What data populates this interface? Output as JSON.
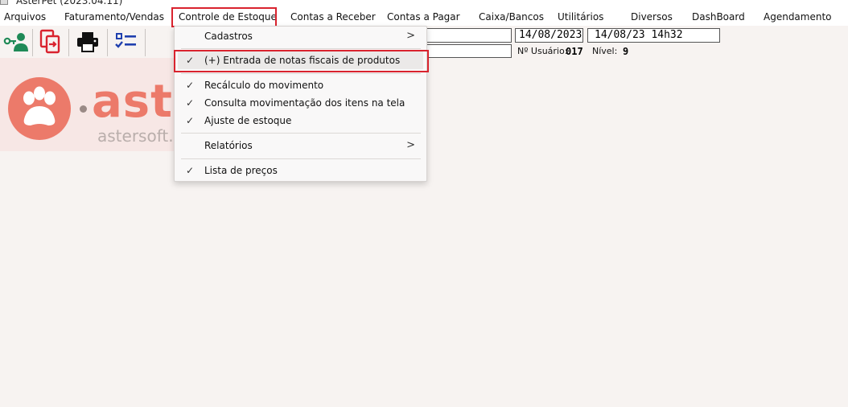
{
  "window": {
    "title": "AsterPet (2023.04.11)"
  },
  "menubar": [
    {
      "label": "Arquivos"
    },
    {
      "label": "Faturamento/Vendas"
    },
    {
      "label": "Controle de Estoque"
    },
    {
      "label": "Contas a Receber"
    },
    {
      "label": "Contas a Pagar"
    },
    {
      "label": "Caixa/Bancos"
    },
    {
      "label": "Utilitários"
    },
    {
      "label": "Diversos"
    },
    {
      "label": "DashBoard"
    },
    {
      "label": "Agendamento"
    }
  ],
  "toolbar": {
    "icons": [
      "user-key-icon",
      "document-switch-icon",
      "printer-icon",
      "checklist-icon"
    ],
    "colors": {
      "user": "#1f8a57",
      "doc": "#d9232e",
      "printer": "#111111",
      "checklist": "#1f3fae"
    }
  },
  "status": {
    "date": "14/08/2023",
    "datetime": "14/08/23 14h32",
    "user_label": "Nº Usuário:",
    "user_value": "017",
    "level_label": "Nível:",
    "level_value": "9"
  },
  "logo": {
    "wordmark": "aster",
    "subtext": "astersoft.com",
    "accent": "#ec7a6a"
  },
  "dropdown": {
    "items": [
      {
        "label": "Cadastros",
        "check": "",
        "submenu": ">"
      },
      {
        "label": "(+) Entrada de notas fiscais de produtos",
        "check": "✓",
        "submenu": ""
      },
      {
        "label": "Recálculo do movimento",
        "check": "✓",
        "submenu": ""
      },
      {
        "label": "Consulta movimentação dos itens na tela",
        "check": "✓",
        "submenu": ""
      },
      {
        "label": "Ajuste de estoque",
        "check": "✓",
        "submenu": ""
      },
      {
        "label": "Relatórios",
        "check": "",
        "submenu": ">"
      },
      {
        "label": "Lista de preços",
        "check": "✓",
        "submenu": ""
      }
    ]
  },
  "highlight_color": "#d9232e"
}
